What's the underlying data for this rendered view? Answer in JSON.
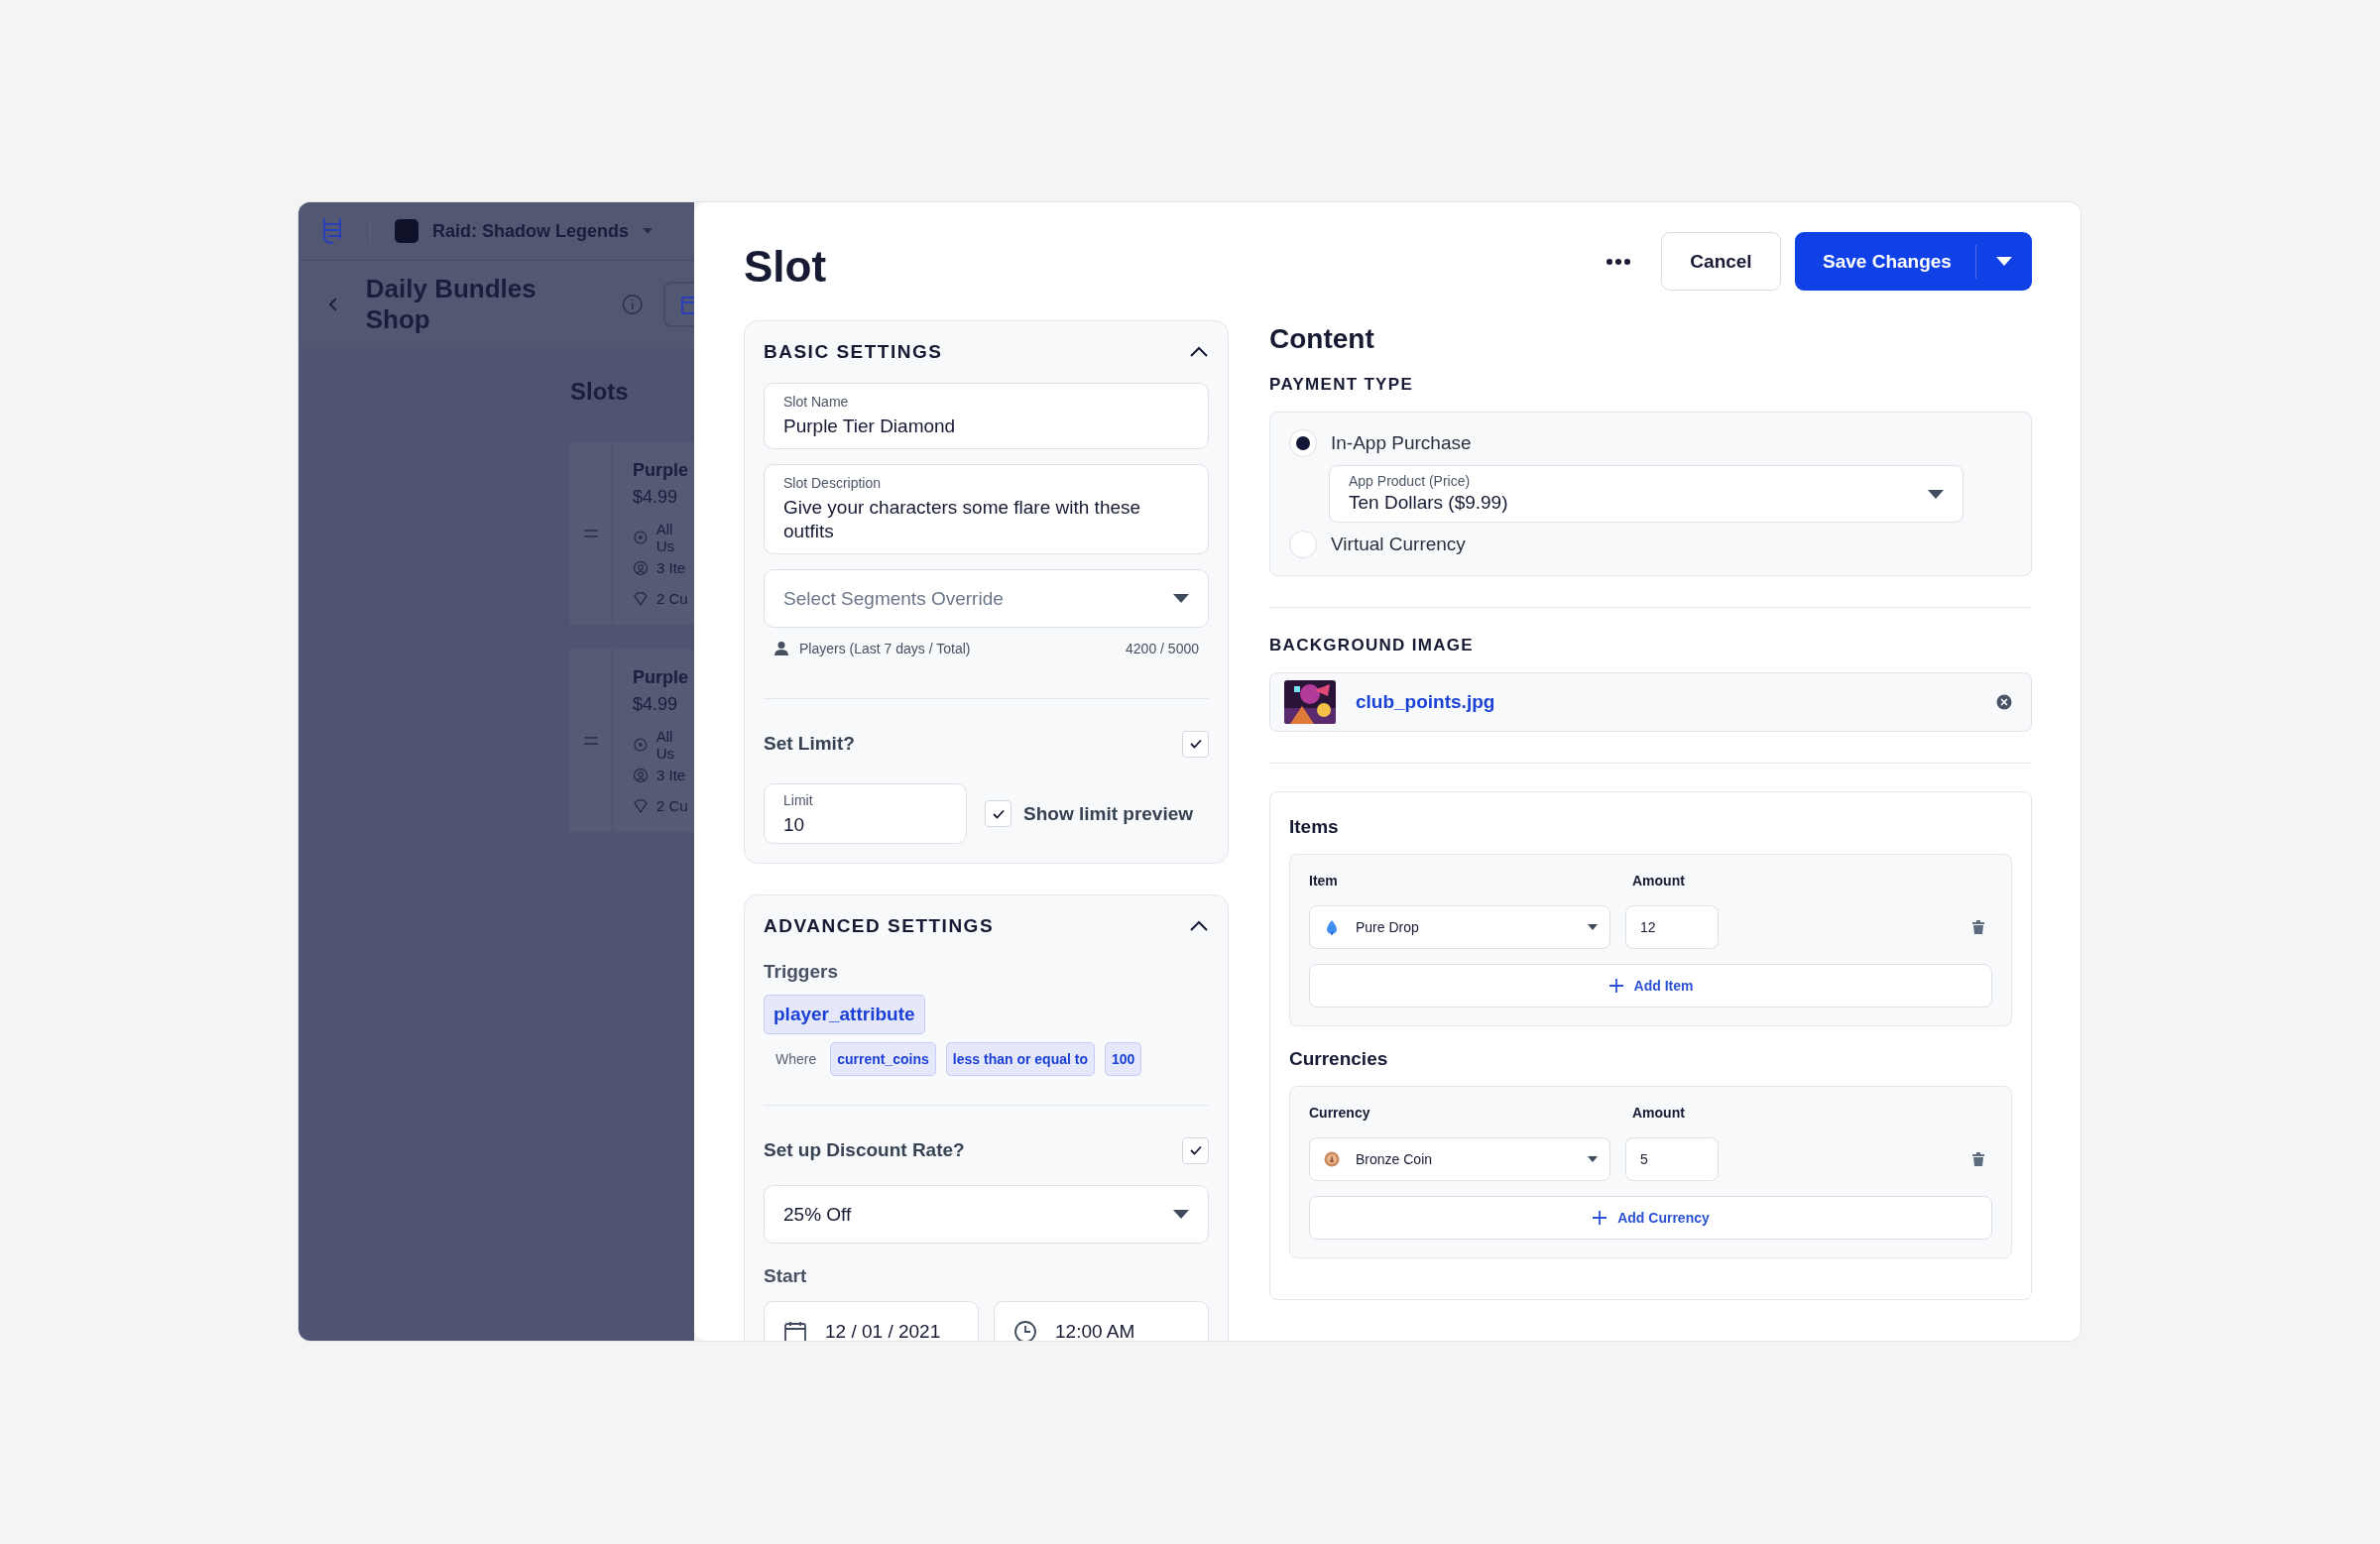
{
  "app_bar": {
    "product": "Raid: Shadow Legends"
  },
  "page": {
    "title": "Daily Bundles Shop",
    "section": "Slots"
  },
  "slot_cards": [
    {
      "name": "Purple",
      "price": "$4.99",
      "details": [
        {
          "kind": "target",
          "text": "All Us"
        },
        {
          "kind": "items",
          "text": "3 Ite"
        },
        {
          "kind": "currency",
          "text": "2 Cu"
        }
      ]
    },
    {
      "name": "Purple",
      "price": "$4.99",
      "details": [
        {
          "kind": "target",
          "text": "All Us"
        },
        {
          "kind": "items",
          "text": "3 Ite"
        },
        {
          "kind": "currency",
          "text": "2 Cu"
        }
      ]
    }
  ],
  "modal": {
    "title": "Slot",
    "cancel": "Cancel",
    "save": "Save Changes"
  },
  "basic_settings": {
    "title": "BASIC SETTINGS",
    "expanded": true,
    "fields": [
      {
        "label": "Slot Name",
        "value": "Purple Tier Diamond"
      },
      {
        "label": "Slot Description",
        "value": "Give your characters some flare with these outfits"
      }
    ],
    "segments": {
      "placeholder": "Select Segments Override"
    },
    "players": {
      "label": "Players (Last 7 days / Total)",
      "value": "4200 / 5000"
    },
    "set_limit": {
      "label": "Set Limit?",
      "checked": true
    },
    "limit": {
      "label": "Limit",
      "value": "10"
    },
    "show_limit_preview": {
      "label": "Show limit preview",
      "checked": true
    }
  },
  "advanced_settings": {
    "title": "ADVANCED SETTINGS",
    "expanded": true,
    "triggers_label": "Triggers",
    "trigger": "player_attribute",
    "where_label": "Where",
    "conditions": [
      "current_coins",
      "less than or equal to",
      "100"
    ],
    "discount": {
      "label": "Set up Discount Rate?",
      "checked": true,
      "value": "25% Off"
    },
    "start": {
      "label": "Start",
      "date": "12 / 01 / 2021",
      "time": "12:00 AM"
    }
  },
  "content": {
    "title": "Content",
    "payment_type": {
      "title": "PAYMENT TYPE",
      "options": [
        {
          "label": "In-App Purchase",
          "selected": true
        },
        {
          "label": "Virtual Currency",
          "selected": false
        }
      ],
      "app_product": {
        "label": "App Product (Price)",
        "value": "Ten Dollars ($9.99)"
      }
    },
    "background_image": {
      "title": "BACKGROUND IMAGE",
      "file": "club_points.jpg"
    },
    "groups": [
      {
        "title": "Items",
        "column_labels": [
          "Item",
          "Amount"
        ],
        "rows": [
          {
            "kind": "drop",
            "name": "Pure Drop",
            "amount": "12"
          }
        ],
        "add": "Add Item"
      },
      {
        "title": "Currencies",
        "column_labels": [
          "Currency",
          "Amount"
        ],
        "rows": [
          {
            "kind": "coin",
            "name": "Bronze Coin",
            "amount": "5"
          }
        ],
        "add": "Add Currency"
      }
    ]
  }
}
